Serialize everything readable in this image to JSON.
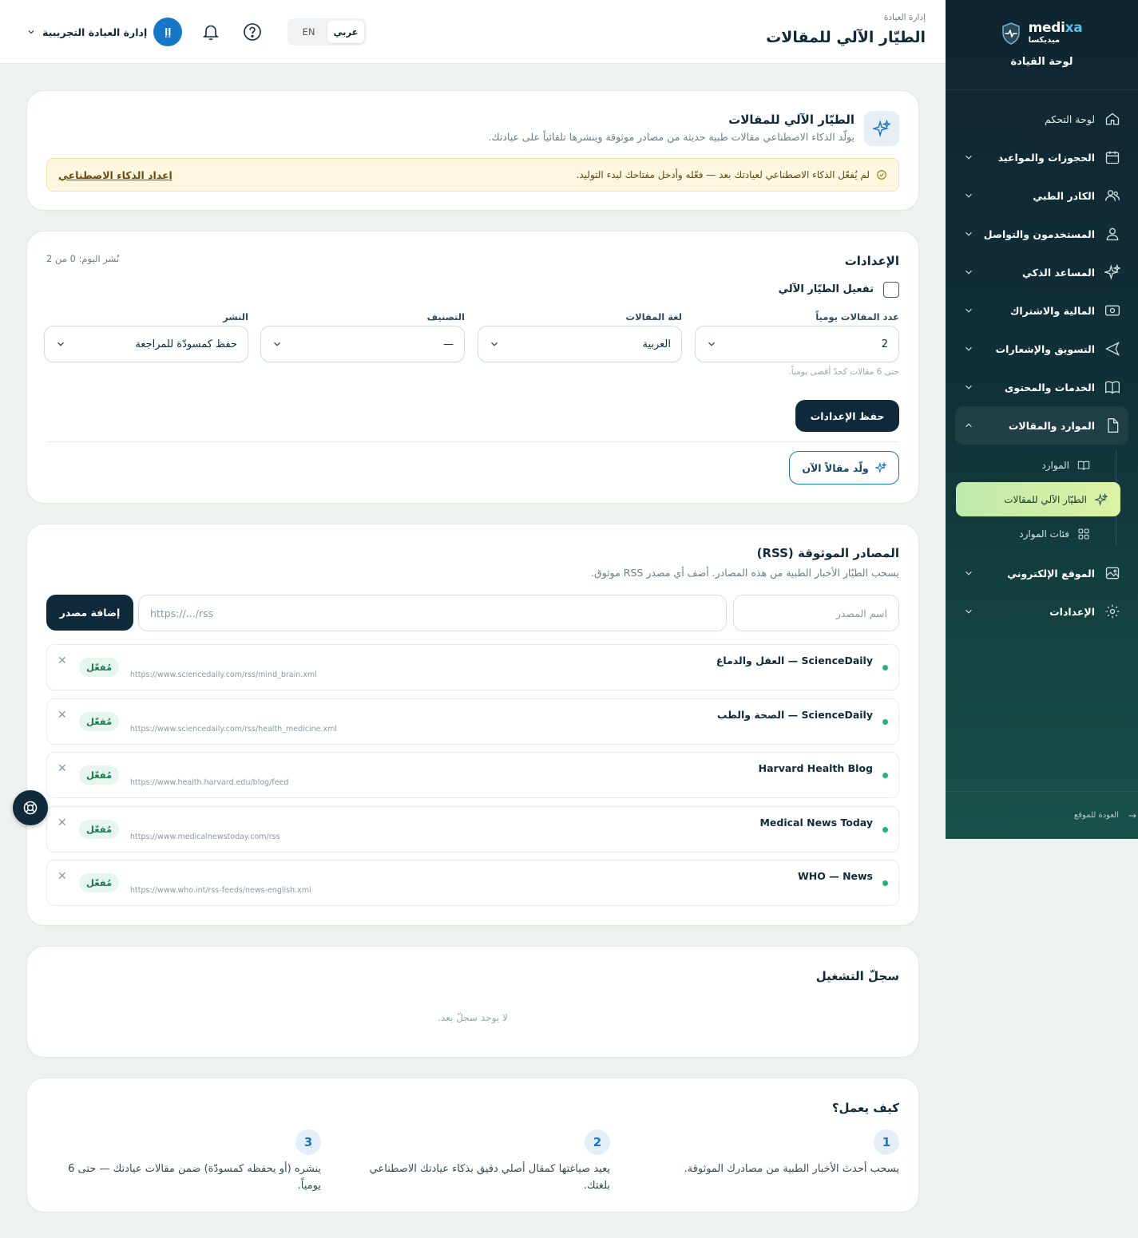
{
  "brand": {
    "name_a": "medi",
    "name_b": "xa",
    "name_ar": "ميديكسا",
    "subtitle": "لوحة القيادة"
  },
  "sidebar": {
    "items": [
      {
        "label": "لوحة التحكم",
        "icon": "home-icon"
      },
      {
        "label": "الحجوزات والمواعيد",
        "icon": "calendar-icon"
      },
      {
        "label": "الكادر الطبي",
        "icon": "users-icon"
      },
      {
        "label": "المستخدمون والتواصل",
        "icon": "user-icon"
      },
      {
        "label": "المساعد الذكي",
        "icon": "sparkle-icon"
      },
      {
        "label": "المالية والاشتراك",
        "icon": "money-icon"
      },
      {
        "label": "التسويق والإشعارات",
        "icon": "send-icon"
      },
      {
        "label": "الخدمات والمحتوى",
        "icon": "book-icon"
      },
      {
        "label": "الموارد والمقالات",
        "icon": "file-icon"
      }
    ],
    "sub_items": [
      {
        "label": "الموارد",
        "icon": "book-open-icon"
      },
      {
        "label": "الطيّار الآلي للمقالات",
        "icon": "sparkle-icon"
      },
      {
        "label": "فئات الموارد",
        "icon": "grid-icon"
      }
    ],
    "items_after": [
      {
        "label": "الموقع الإلكتروني",
        "icon": "image-icon"
      },
      {
        "label": "الإعدادات",
        "icon": "gear-icon"
      }
    ],
    "back_label": "العودة للموقع"
  },
  "topbar": {
    "breadcrumb": "إدارة العيادة",
    "title": "الطيّار الآلي للمقالات",
    "lang_ar": "عربي",
    "lang_en": "EN",
    "avatar_initials": "إإ",
    "user_name": "إدارة العيادة التجريبية"
  },
  "hero": {
    "title": "الطيّار الآلي للمقالات",
    "description": "يولّد الذكاء الاصطناعي مقالات طبية حديثة من مصادر موثوقة وينشرها تلقائياً على عيادتك.",
    "warning": "لم يُفعّل الذكاء الاصطناعي لعيادتك بعد — فعّله وأدخل مفتاحك لبدء التوليد.",
    "warning_link": "إعداد الذكاء الاصطناعي"
  },
  "settings": {
    "title": "الإعدادات",
    "published_today": "نُشر اليوم: 0 من 2",
    "enable_label": "تفعيل الطيّار الآلي",
    "daily_label": "عدد المقالات يومياً",
    "daily_value": "2",
    "daily_hint": "حتى 6 مقالات كحدّ أقصى يومياً.",
    "language_label": "لغة المقالات",
    "language_value": "العربية",
    "category_label": "التصنيف",
    "category_value": "—",
    "publish_label": "النشر",
    "publish_value": "حفظ كمسودّة للمراجعة",
    "save_button": "حفظ الإعدادات",
    "generate_button": "ولّد مقالاً الآن"
  },
  "rss": {
    "title": "المصادر الموثوقة (RSS)",
    "description": "يسحب الطيّار الأخبار الطبية من هذه المصادر. أضف أي مصدر RSS موثوق.",
    "name_placeholder": "اسم المصدر",
    "url_placeholder": "https://.../rss",
    "add_button": "إضافة مصدر",
    "sources": [
      {
        "name": "ScienceDaily — العقل والدماغ",
        "url": "https://www.sciencedaily.com/rss/mind_brain.xml",
        "status": "مُفعّل"
      },
      {
        "name": "ScienceDaily — الصحة والطب",
        "url": "https://www.sciencedaily.com/rss/health_medicine.xml",
        "status": "مُفعّل"
      },
      {
        "name": "Harvard Health Blog",
        "url": "https://www.health.harvard.edu/blog/feed",
        "status": "مُفعّل"
      },
      {
        "name": "Medical News Today",
        "url": "https://www.medicalnewstoday.com/rss",
        "status": "مُفعّل"
      },
      {
        "name": "WHO — News",
        "url": "https://www.who.int/rss-feeds/news-english.xml",
        "status": "مُفعّل"
      }
    ]
  },
  "log": {
    "title": "سجلّ التشغيل",
    "empty": "لا يوجد سجلّ بعد."
  },
  "how": {
    "title": "كيف يعمل؟",
    "steps": [
      {
        "num": "1",
        "text": "يسحب أحدث الأخبار الطبية من مصادرك الموثوقة."
      },
      {
        "num": "2",
        "text": "يعيد صياغتها كمقال أصلي دقيق بذكاء عيادتك الاصطناعي بلغتك."
      },
      {
        "num": "3",
        "text": "ينشره (أو يحفظه كمسودّة) ضمن مقالات عيادتك — حتى 6 يومياً."
      }
    ]
  },
  "colors": {
    "accent": "#1677c9",
    "dark": "#0f2a3b",
    "active_badge": "#1a7a4c"
  }
}
